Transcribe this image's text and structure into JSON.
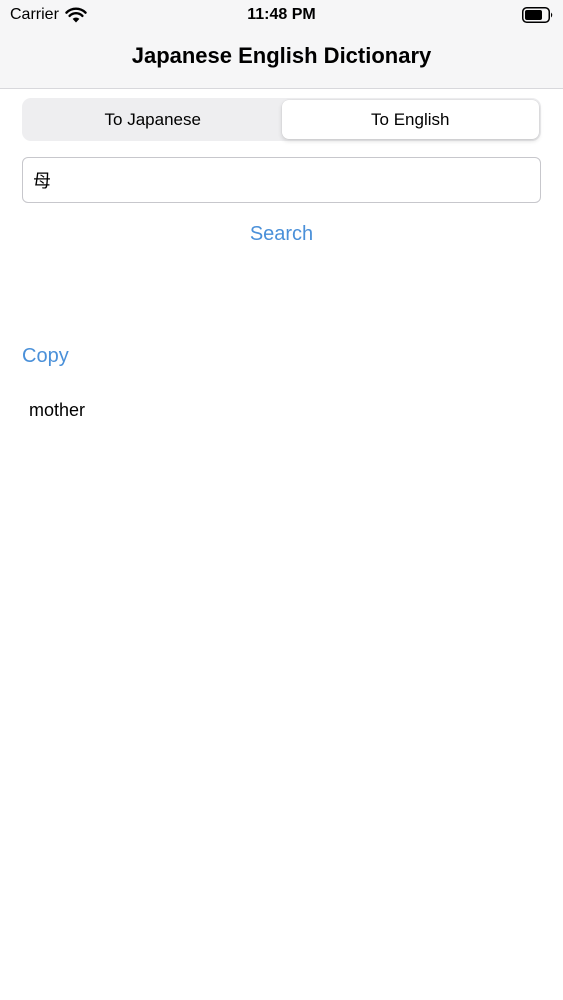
{
  "status_bar": {
    "carrier": "Carrier",
    "time": "11:48 PM",
    "icons": [
      "wifi-icon",
      "battery-icon"
    ]
  },
  "nav": {
    "title": "Japanese English Dictionary"
  },
  "segmented_control": {
    "options": [
      {
        "label": "To Japanese",
        "selected": false
      },
      {
        "label": "To English",
        "selected": true
      }
    ]
  },
  "search": {
    "value": "母",
    "button_label": "Search"
  },
  "result": {
    "copy_label": "Copy",
    "text": "mother"
  },
  "colors": {
    "accent": "#4a90d9",
    "nav_background": "#f6f6f7",
    "segment_background": "#eeeef0"
  }
}
